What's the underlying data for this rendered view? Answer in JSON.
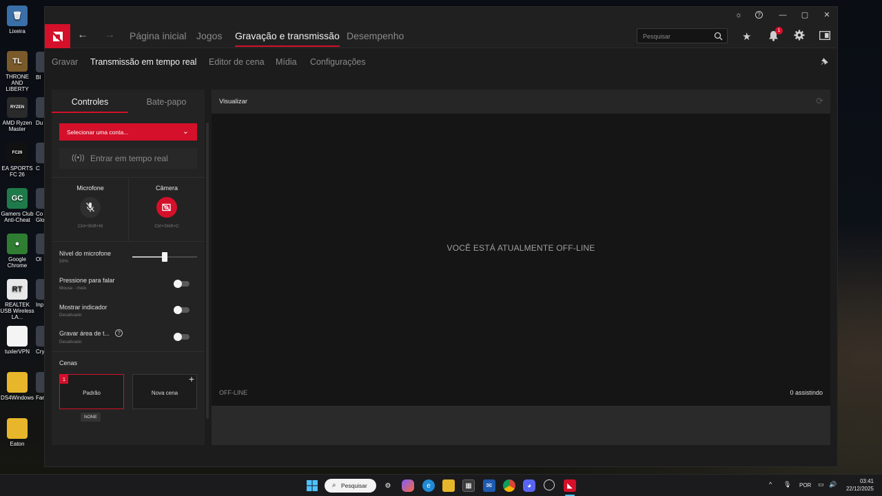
{
  "desktop": {
    "icons": [
      {
        "label": "Lixeira",
        "glyph": "🗑",
        "color": "#3a6fa8"
      },
      {
        "label": "THRONE AND LIBERTY",
        "glyph": "TL",
        "color": "#7a5a2a"
      },
      {
        "label": "AMD Ryzen Master",
        "glyph": "RYZEN",
        "color": "#2a2a2a"
      },
      {
        "label": "EA SPORTS FC 26",
        "glyph": "FC26",
        "color": "#111111"
      },
      {
        "label": "Gamers Club Anti-Cheat",
        "glyph": "GC",
        "color": "#1f7a4a"
      },
      {
        "label": "Google Chrome",
        "glyph": "●",
        "color": "#2f7d32"
      },
      {
        "label": "REALTEK USB Wireless LA...",
        "glyph": "RT",
        "color": "#e8e8e8"
      },
      {
        "label": "tuxlerVPN",
        "glyph": "",
        "color": "#f4f4f4"
      },
      {
        "label": "DS4Windows",
        "glyph": "",
        "color": "#e8b62a"
      },
      {
        "label": "Eaton",
        "glyph": "",
        "color": "#e8b62a"
      }
    ],
    "partial_labels": [
      "Bl",
      "Du",
      "C",
      "Co Glo",
      "Ol",
      "Inp",
      "Cry",
      "Far"
    ]
  },
  "window": {
    "controls": {
      "bug": "☼",
      "help": "?",
      "minimize": "—",
      "maximize": "▢",
      "close": "✕"
    }
  },
  "nav": {
    "back": "←",
    "forward": "→",
    "tabs": [
      "Página inicial",
      "Jogos",
      "Gravação e transmissão",
      "Desempenho"
    ],
    "active_tab": "Gravação e transmissão",
    "search_placeholder": "Pesquisar",
    "notification_count": "1"
  },
  "subnav": {
    "tabs": [
      "Gravar",
      "Transmissão em tempo real",
      "Editor de cena",
      "Mídia",
      "Configurações"
    ],
    "active_tab": "Transmissão em tempo real"
  },
  "left_panel": {
    "tabs": [
      "Controles",
      "Bate-papo"
    ],
    "account_select": "Selecionar uma conta...",
    "go_live": "Entrar em tempo real",
    "microphone": {
      "label": "Microfone",
      "shortcut": "Ctrl+Shift+M"
    },
    "camera": {
      "label": "Câmera",
      "shortcut": "Ctrl+Shift+C"
    },
    "mic_level": {
      "label": "Nível do microfone",
      "value_text": "50%",
      "value": 0.5
    },
    "push_to_talk": {
      "label": "Pressione para falar",
      "sub": "Mouse - meio"
    },
    "show_indicator": {
      "label": "Mostrar indicador",
      "sub": "Desativado"
    },
    "record_desktop": {
      "label": "Gravar área de t...",
      "sub": "Desativado"
    },
    "scenes": {
      "title": "Cenas",
      "items": [
        {
          "name": "Padrão",
          "number": "1",
          "tag": "NONE"
        },
        {
          "name": "Nova cena"
        }
      ]
    }
  },
  "preview": {
    "title": "Visualizar",
    "message": "VOCÊ ESTÁ ATUALMENTE OFF-LINE",
    "status": "OFF-LINE",
    "viewers": "0 assistindo"
  },
  "taskbar": {
    "search": "Pesquisar",
    "lang": "POR",
    "time": "03:41",
    "date": "22/12/2025"
  },
  "colors": {
    "accent": "#d4102a",
    "panel": "#232323",
    "window": "#1c1c1c"
  }
}
